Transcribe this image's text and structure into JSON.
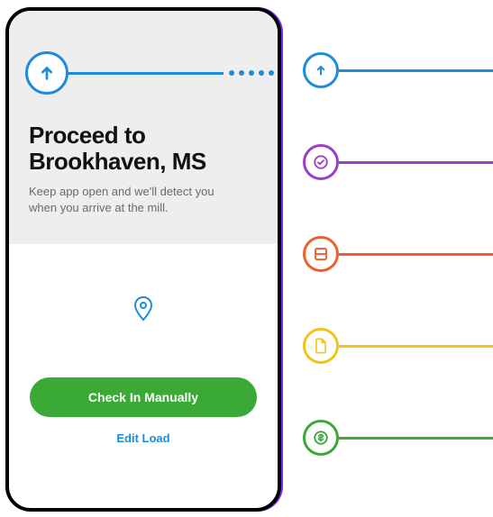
{
  "phone": {
    "heading": "Proceed to Brookhaven, MS",
    "subtext": "Keep app open and we'll detect you when you arrive at the mill.",
    "checkin_button": "Check In Manually",
    "edit_link": "Edit Load"
  },
  "colors": {
    "blue": "#1c8dd6",
    "purple": "#9b3fc6",
    "orange": "#ed5f2d",
    "yellow": "#f0c419",
    "green": "#3aa935"
  },
  "features": [
    {
      "name": "upload",
      "color": "blue"
    },
    {
      "name": "check",
      "color": "purple"
    },
    {
      "name": "scan",
      "color": "orange"
    },
    {
      "name": "doc",
      "color": "yellow"
    },
    {
      "name": "paid",
      "color": "green"
    }
  ]
}
